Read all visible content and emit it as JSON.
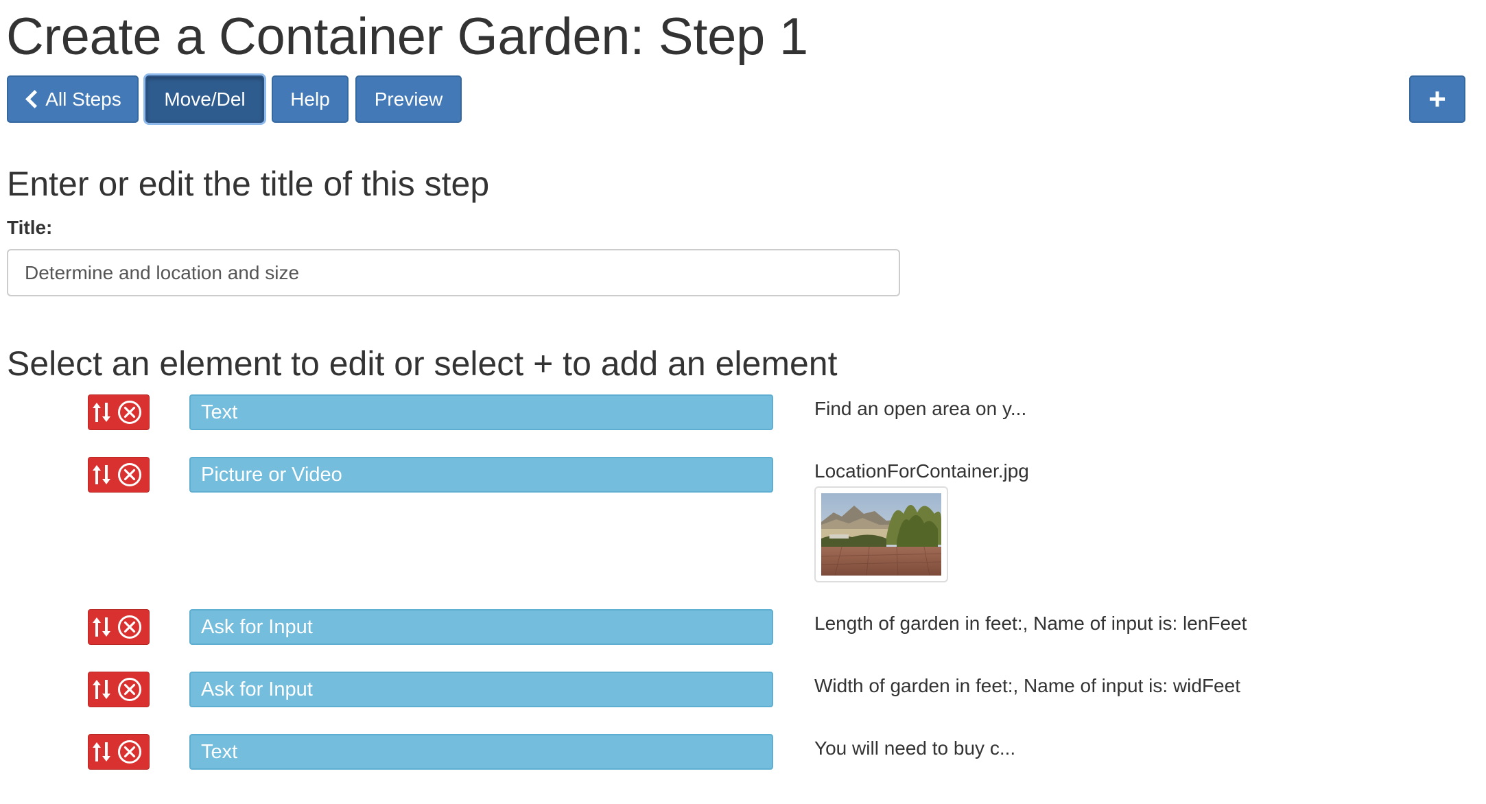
{
  "page_title": "Create a Container Garden: Step 1",
  "toolbar": {
    "all_steps_label": "All Steps",
    "move_del_label": "Move/Del",
    "help_label": "Help",
    "preview_label": "Preview",
    "add_label": "+"
  },
  "title_section": {
    "heading": "Enter or edit the title of this step",
    "field_label": "Title:",
    "field_value": "Determine and location and size"
  },
  "elements_section": {
    "heading": "Select an element to edit or select + to add an element",
    "items": [
      {
        "type": "Text",
        "summary": "Find an open area on y..."
      },
      {
        "type": "Picture or Video",
        "summary": "LocationForContainer.jpg",
        "thumbnail": "garden-location-photo"
      },
      {
        "type": "Ask for Input",
        "summary": "Length of garden in feet:, Name of input is: lenFeet"
      },
      {
        "type": "Ask for Input",
        "summary": "Width of garden in feet:, Name of input is: widFeet"
      },
      {
        "type": "Text",
        "summary": "You will need to buy c..."
      }
    ]
  },
  "icons": {
    "back": "chevron-left-icon",
    "move": "move-up-down-icon",
    "delete": "remove-circle-icon",
    "add": "plus-icon"
  },
  "colors": {
    "primary_button": "#4379b6",
    "primary_button_active": "#2f5c8f",
    "element_button": "#74bddc",
    "danger": "#d9312f",
    "text": "#333333"
  }
}
